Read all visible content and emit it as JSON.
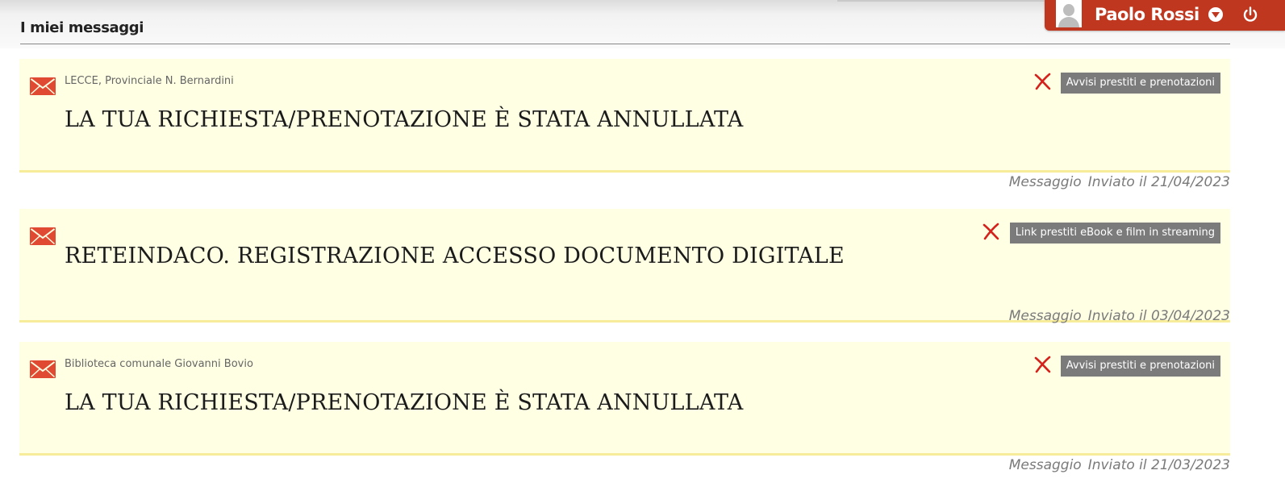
{
  "user": {
    "name": "Paolo Rossi",
    "avatar_icon": "user-avatar-icon",
    "menu_icon": "chevron-down-icon",
    "logout_icon": "power-icon",
    "bar_color": "#c0371f"
  },
  "page": {
    "title": "I miei messaggi"
  },
  "messages": [
    {
      "source": "LECCE, Provinciale N. Bernardini",
      "subject": "LA TUA RICHIESTA/PRENOTAZIONE È STATA ANNULLATA",
      "category": "Avvisi prestiti e prenotazioni",
      "type_label": "Messaggio",
      "sent_label": "Inviato il 21/04/2023"
    },
    {
      "source": "",
      "subject": "RETEINDACO. REGISTRAZIONE ACCESSO DOCUMENTO DIGITALE",
      "category": "Link prestiti eBook e film in streaming",
      "type_label": "Messaggio",
      "sent_label": "Inviato il 03/04/2023"
    },
    {
      "source": "Biblioteca comunale Giovanni Bovio",
      "subject": "LA TUA RICHIESTA/PRENOTAZIONE È STATA ANNULLATA",
      "category": "Avvisi prestiti e prenotazioni",
      "type_label": "Messaggio",
      "sent_label": "Inviato il 21/03/2023"
    }
  ],
  "colors": {
    "card_background": "#ffffe3",
    "card_border": "#f6ec9a",
    "category_badge": "#7b7b7b",
    "envelope": "#e04a32",
    "delete": "#d4211b"
  }
}
